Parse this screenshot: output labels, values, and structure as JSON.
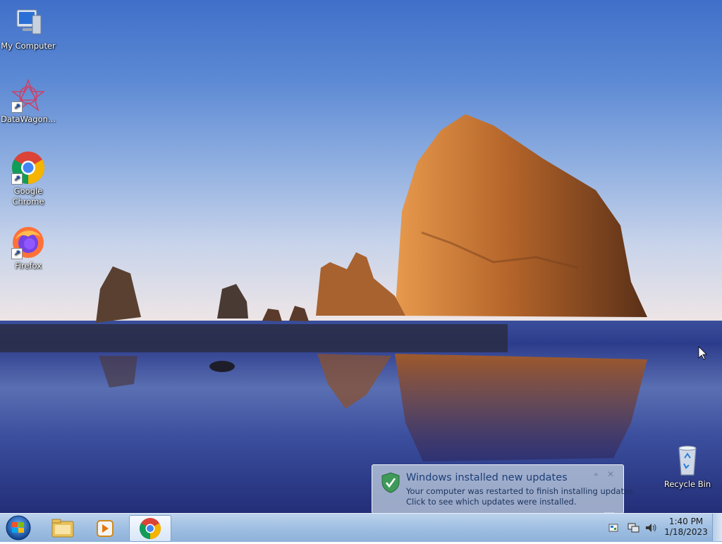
{
  "desktop_icons": [
    {
      "label": "My Computer",
      "icon": "computer-icon"
    },
    {
      "label": "DataWagon...",
      "icon": "datawagon-icon"
    },
    {
      "label": "Google Chrome",
      "icon": "chrome-icon"
    },
    {
      "label": "Firefox",
      "icon": "firefox-icon"
    },
    {
      "label": "Recycle Bin",
      "icon": "recycle-bin-icon"
    }
  ],
  "taskbar": {
    "start_icon": "windows-start-icon",
    "pinned": [
      {
        "name": "Windows Explorer",
        "icon": "folder-icon"
      },
      {
        "name": "Windows Media Player",
        "icon": "media-player-icon"
      },
      {
        "name": "Google Chrome",
        "icon": "chrome-icon",
        "active": true
      }
    ]
  },
  "tray": {
    "time": "1:40 PM",
    "date": "1/18/2023",
    "icons": [
      "action-center-icon",
      "network-icon",
      "volume-icon"
    ]
  },
  "notification": {
    "title": "Windows installed new updates",
    "line1": "Your computer was restarted to finish installing updates.",
    "line2": "Click to see which updates were installed.",
    "icon": "shield-check-icon"
  },
  "colors": {
    "taskbar": "#9fbfe2",
    "balloon_title": "#1c3f78",
    "sky_top": "#3f6fc9",
    "rock": "#b5652a"
  }
}
